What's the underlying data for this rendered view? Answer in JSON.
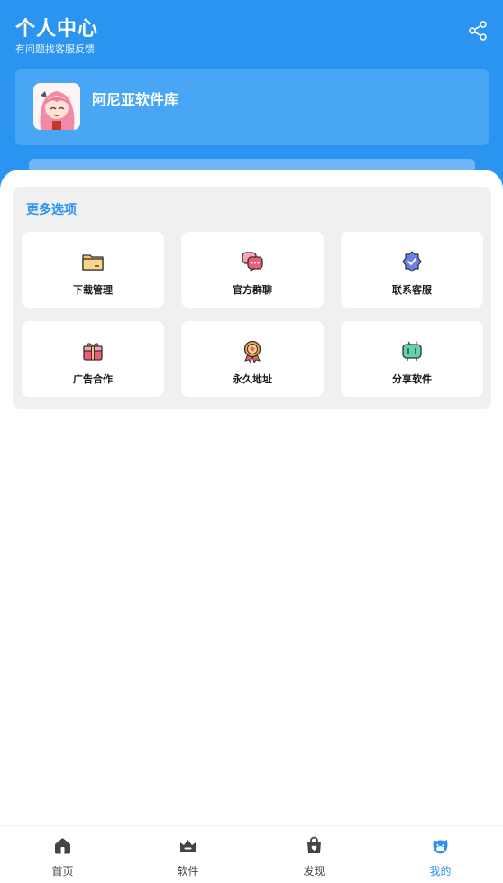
{
  "header": {
    "title": "个人中心",
    "subtitle": "有问题找客服反馈",
    "share_icon": "share-icon",
    "bg_color": "#2b93f0"
  },
  "profile": {
    "name": "阿尼亚软件库",
    "avatar_icon": "anime-avatar"
  },
  "options": {
    "title": "更多选项",
    "items": [
      {
        "label": "下载管理",
        "icon": "folder-icon"
      },
      {
        "label": "官方群聊",
        "icon": "chat-icon"
      },
      {
        "label": "联系客服",
        "icon": "verified-badge-icon"
      },
      {
        "label": "广告合作",
        "icon": "gift-icon"
      },
      {
        "label": "永久地址",
        "icon": "medal-icon"
      },
      {
        "label": "分享软件",
        "icon": "tv-icon"
      }
    ]
  },
  "tabbar": {
    "items": [
      {
        "label": "首页",
        "icon": "home-icon"
      },
      {
        "label": "软件",
        "icon": "crown-box-icon"
      },
      {
        "label": "发现",
        "icon": "bag-heart-icon"
      },
      {
        "label": "我的",
        "icon": "cat-face-icon",
        "active": true
      }
    ],
    "active_color": "#2b93f0"
  }
}
